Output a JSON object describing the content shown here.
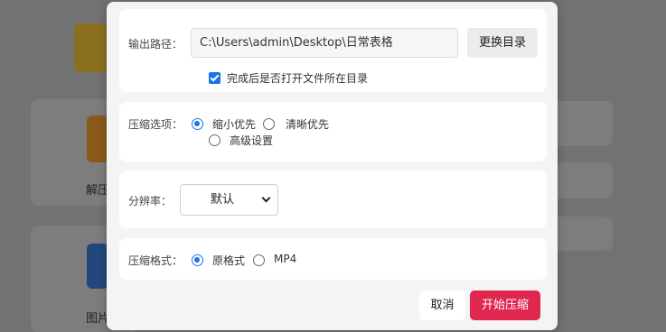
{
  "background": {
    "labels": [
      "解压",
      "图片"
    ]
  },
  "dialog": {
    "output": {
      "label": "输出路径：",
      "path": "C:\\Users\\admin\\Desktop\\日常表格",
      "change_button": "更换目录",
      "open_after_label": "完成后是否打开文件所在目录",
      "open_after_checked": true
    },
    "compress": {
      "label": "压缩选项：",
      "options": [
        "缩小优先",
        "清晰优先",
        "高级设置"
      ],
      "selected": "缩小优先"
    },
    "resolution": {
      "label": "分辨率：",
      "selected": "默认"
    },
    "format": {
      "label": "压缩格式：",
      "options": [
        "原格式",
        "MP4"
      ],
      "selected": "原格式"
    },
    "footer": {
      "cancel_label": "取消",
      "start_label": "开始压缩"
    }
  },
  "colors": {
    "accent": "#1a73e8",
    "primary": "#e0274f"
  }
}
